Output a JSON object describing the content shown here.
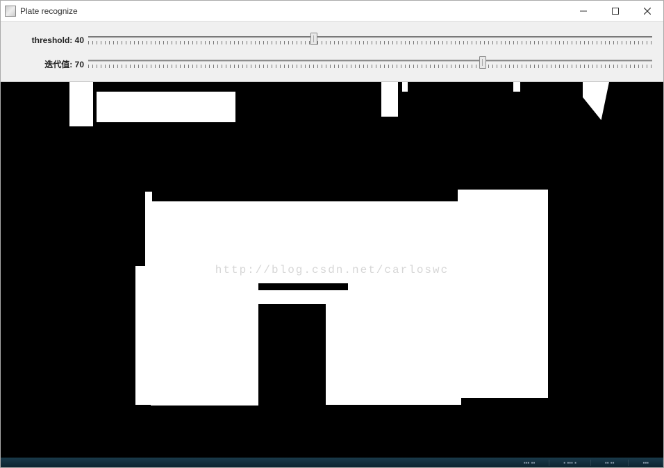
{
  "window": {
    "title": "Plate recognize"
  },
  "sliders": {
    "threshold": {
      "label": "threshold:",
      "value": 40,
      "min": 0,
      "max": 100,
      "position_pct": 40
    },
    "iteration": {
      "label": "迭代值:",
      "value": 70,
      "min": 0,
      "max": 100,
      "position_pct": 70
    }
  },
  "watermark": "http://blog.csdn.net/carloswc"
}
